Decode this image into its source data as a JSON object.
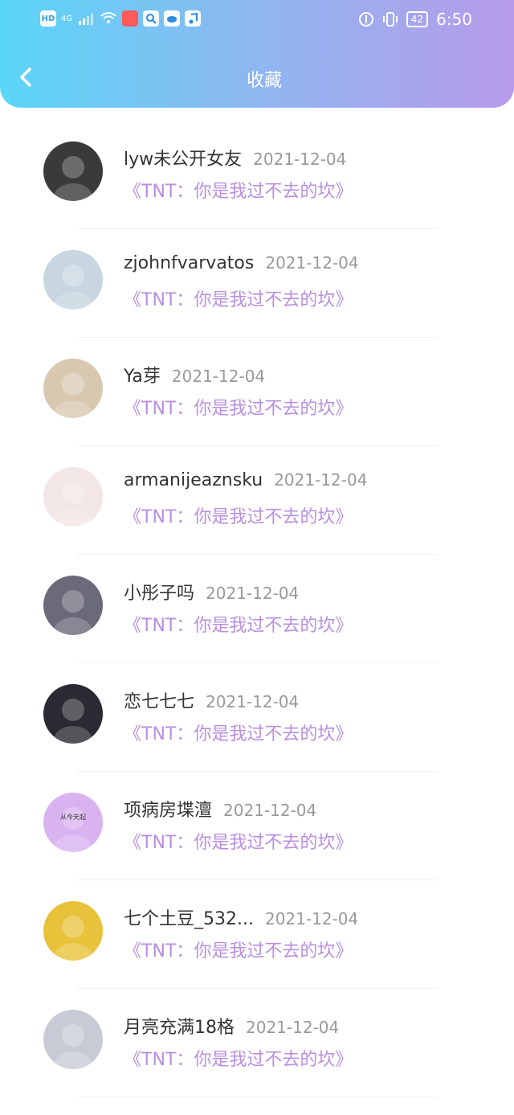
{
  "status_bar": {
    "left_badges": [
      "HD",
      "4G"
    ],
    "battery": "42",
    "time": "6:50"
  },
  "header": {
    "title": "收藏"
  },
  "items": [
    {
      "name": "lyw未公开女友",
      "date": "2021-12-04",
      "subtitle": "《TNT：你是我过不去的坎》",
      "avatar_color": "#3a3a3a"
    },
    {
      "name": "zjohnfvarvatos",
      "date": "2021-12-04",
      "subtitle": "《TNT：你是我过不去的坎》",
      "avatar_color": "#c7d6e0"
    },
    {
      "name": "Ya芽",
      "date": "2021-12-04",
      "subtitle": "《TNT：你是我过不去的坎》",
      "avatar_color": "#d9c8b0"
    },
    {
      "name": "armanijeaznsku",
      "date": "2021-12-04",
      "subtitle": "《TNT：你是我过不去的坎》",
      "avatar_color": "#f3e6e6"
    },
    {
      "name": "小彤子吗",
      "date": "2021-12-04",
      "subtitle": "《TNT：你是我过不去的坎》",
      "avatar_color": "#6b6a7a"
    },
    {
      "name": "恋七七七",
      "date": "2021-12-04",
      "subtitle": "《TNT：你是我过不去的坎》",
      "avatar_color": "#2a2a33"
    },
    {
      "name": "项病房堞澶",
      "date": "2021-12-04",
      "subtitle": "《TNT：你是我过不去的坎》",
      "avatar_color": "#d9b2f0",
      "avatar_text": "从今天起"
    },
    {
      "name": "七个土豆_532...",
      "date": "2021-12-04",
      "subtitle": "《TNT：你是我过不去的坎》",
      "avatar_color": "#e8c23a"
    },
    {
      "name": "月亮充满18格",
      "date": "2021-12-04",
      "subtitle": "《TNT：你是我过不去的坎》",
      "avatar_color": "#c8cbd6"
    }
  ]
}
